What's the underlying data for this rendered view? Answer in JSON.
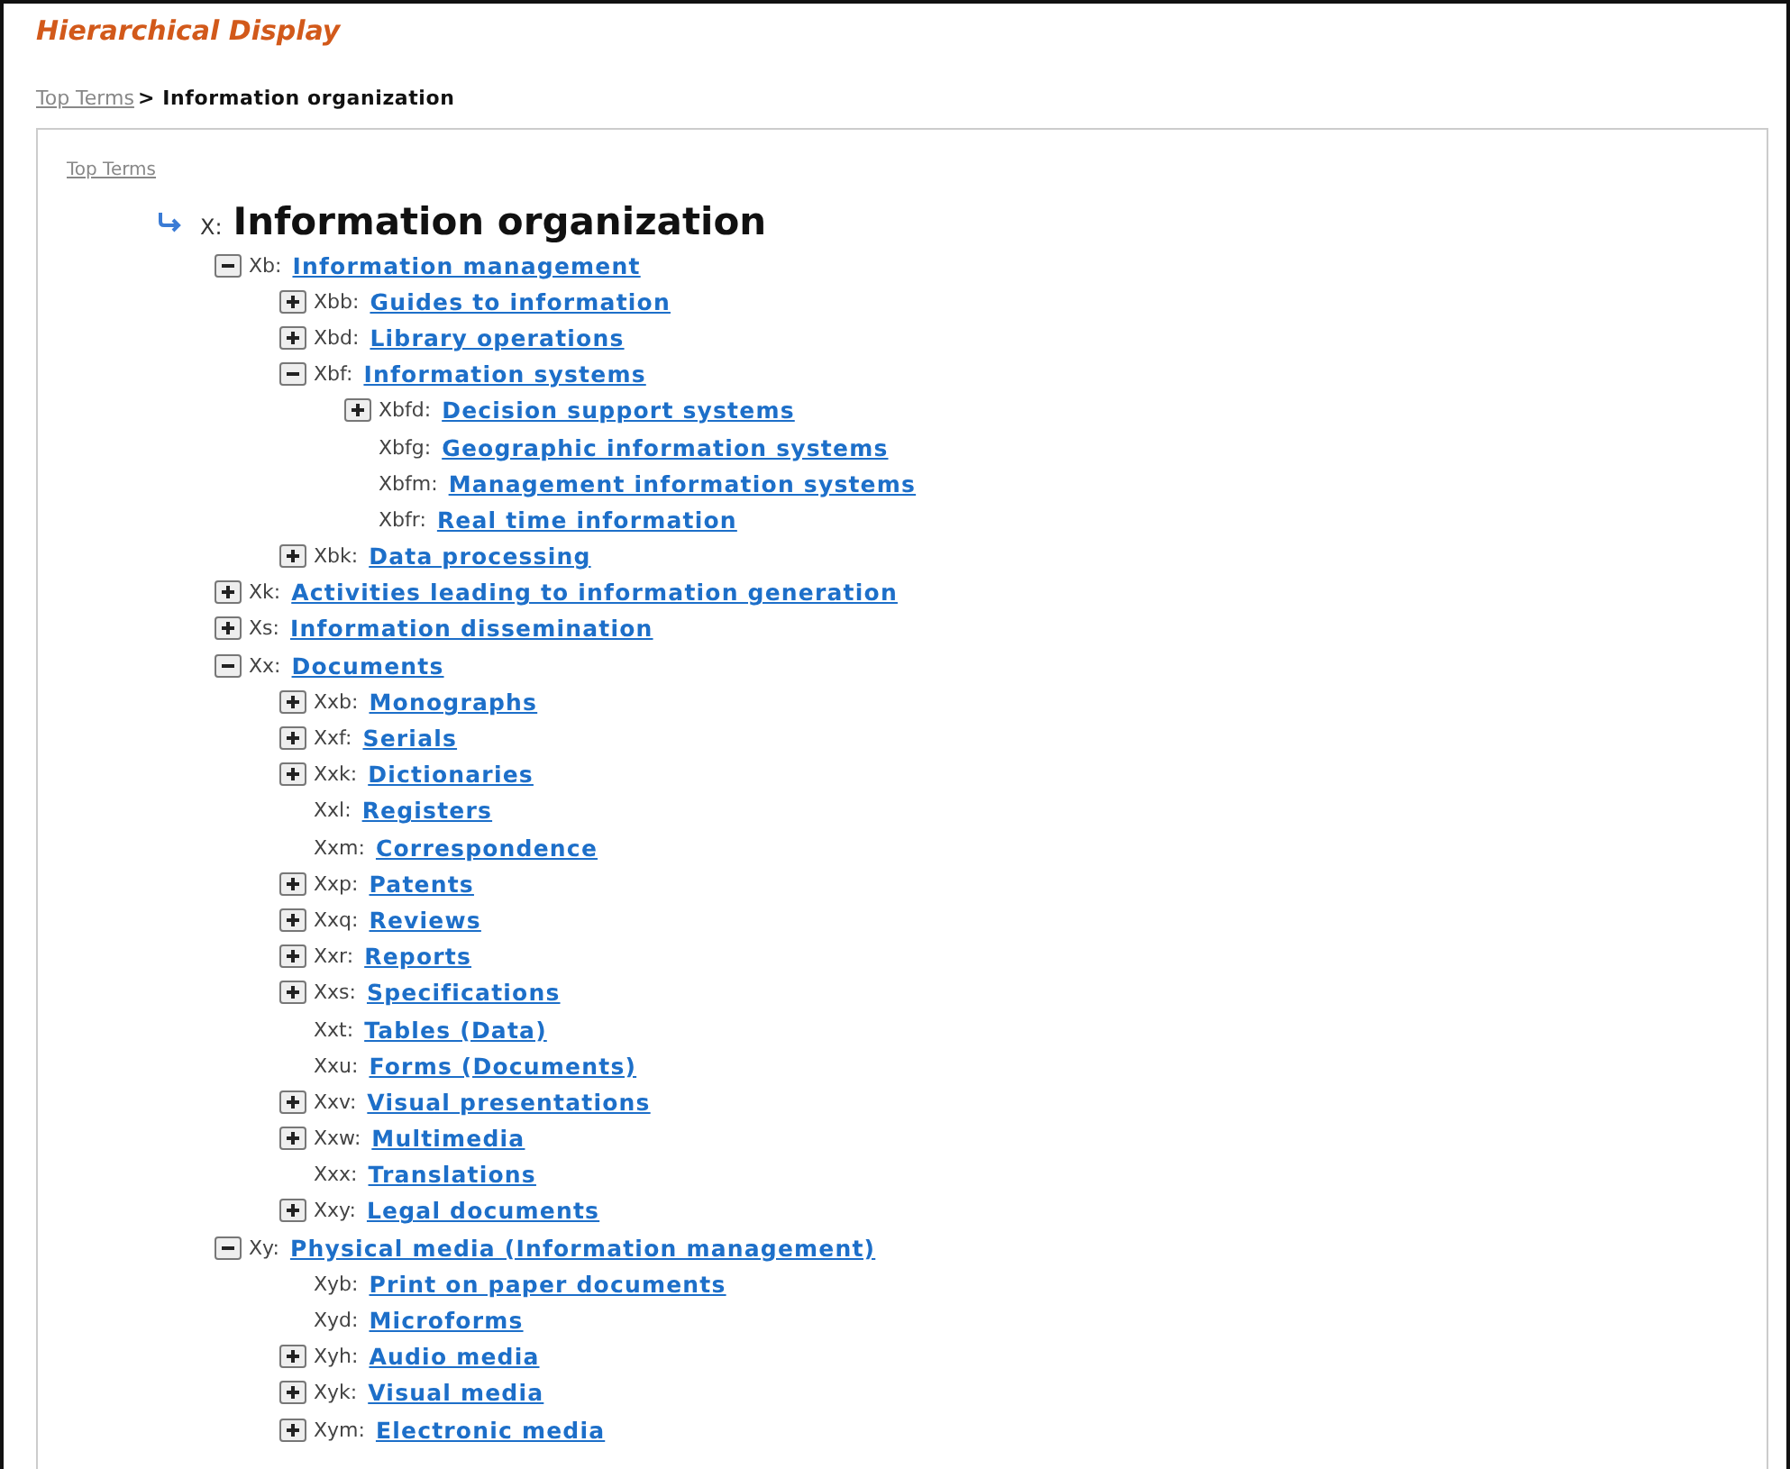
{
  "title": "Hierarchical Display",
  "breadcrumb": {
    "link": "Top Terms",
    "separator": ">",
    "current": "Information organization"
  },
  "tree": {
    "top_link": "Top Terms",
    "root": {
      "code": "X:",
      "label": "Information organization",
      "children": [
        {
          "code": "Xb:",
          "label": "Information management",
          "kind": "expanded",
          "children": [
            {
              "code": "Xbb:",
              "label": "Guides to information",
              "kind": "collapsed"
            },
            {
              "code": "Xbd:",
              "label": "Library operations",
              "kind": "collapsed"
            },
            {
              "code": "Xbf:",
              "label": "Information systems",
              "kind": "expanded",
              "children": [
                {
                  "code": "Xbfd:",
                  "label": "Decision support systems",
                  "kind": "collapsed"
                },
                {
                  "code": "Xbfg:",
                  "label": "Geographic information systems",
                  "kind": "leaf"
                },
                {
                  "code": "Xbfm:",
                  "label": "Management information systems",
                  "kind": "leaf"
                },
                {
                  "code": "Xbfr:",
                  "label": "Real time information",
                  "kind": "leaf"
                }
              ]
            },
            {
              "code": "Xbk:",
              "label": "Data processing",
              "kind": "collapsed"
            }
          ]
        },
        {
          "code": "Xk:",
          "label": "Activities leading to information generation",
          "kind": "collapsed"
        },
        {
          "code": "Xs:",
          "label": "Information dissemination",
          "kind": "collapsed"
        },
        {
          "code": "Xx:",
          "label": "Documents",
          "kind": "expanded",
          "children": [
            {
              "code": "Xxb:",
              "label": "Monographs",
              "kind": "collapsed"
            },
            {
              "code": "Xxf:",
              "label": "Serials",
              "kind": "collapsed"
            },
            {
              "code": "Xxk:",
              "label": "Dictionaries",
              "kind": "collapsed"
            },
            {
              "code": "Xxl:",
              "label": "Registers",
              "kind": "leaf"
            },
            {
              "code": "Xxm:",
              "label": "Correspondence",
              "kind": "leaf"
            },
            {
              "code": "Xxp:",
              "label": "Patents",
              "kind": "collapsed"
            },
            {
              "code": "Xxq:",
              "label": "Reviews",
              "kind": "collapsed"
            },
            {
              "code": "Xxr:",
              "label": "Reports",
              "kind": "collapsed"
            },
            {
              "code": "Xxs:",
              "label": "Specifications",
              "kind": "collapsed"
            },
            {
              "code": "Xxt:",
              "label": "Tables (Data)",
              "kind": "leaf"
            },
            {
              "code": "Xxu:",
              "label": "Forms (Documents)",
              "kind": "leaf"
            },
            {
              "code": "Xxv:",
              "label": "Visual presentations",
              "kind": "collapsed"
            },
            {
              "code": "Xxw:",
              "label": "Multimedia",
              "kind": "collapsed"
            },
            {
              "code": "Xxx:",
              "label": "Translations",
              "kind": "leaf"
            },
            {
              "code": "Xxy:",
              "label": "Legal documents",
              "kind": "collapsed"
            }
          ]
        },
        {
          "code": "Xy:",
          "label": "Physical media (Information management)",
          "kind": "expanded",
          "children": [
            {
              "code": "Xyb:",
              "label": "Print on paper documents",
              "kind": "leaf"
            },
            {
              "code": "Xyd:",
              "label": "Microforms",
              "kind": "leaf"
            },
            {
              "code": "Xyh:",
              "label": "Audio media",
              "kind": "collapsed"
            },
            {
              "code": "Xyk:",
              "label": "Visual media",
              "kind": "collapsed"
            },
            {
              "code": "Xym:",
              "label": "Electronic media",
              "kind": "collapsed"
            }
          ]
        }
      ]
    }
  }
}
